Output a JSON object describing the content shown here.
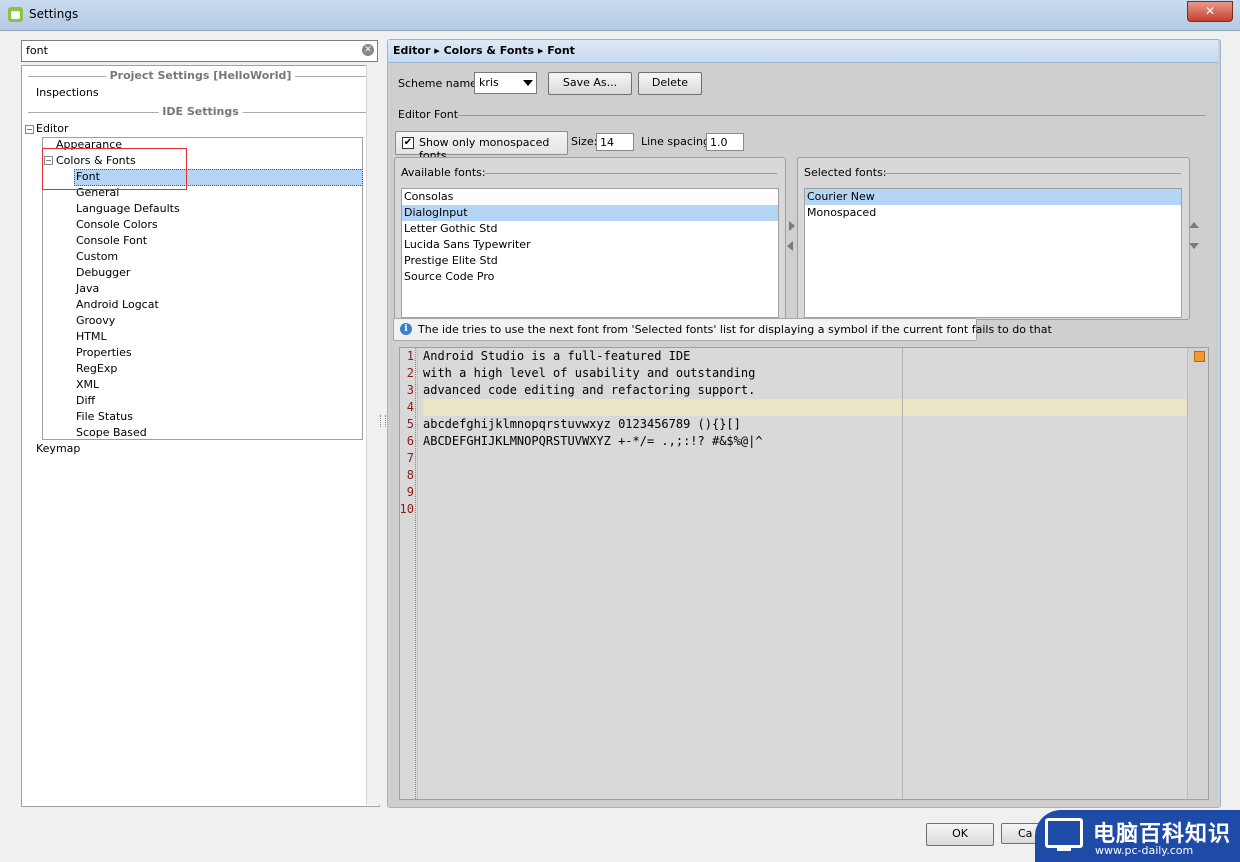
{
  "window": {
    "title": "Settings",
    "close_label": "✕"
  },
  "search": {
    "value": "font"
  },
  "tree": {
    "project_separator": "Project Settings [HelloWorld]",
    "ide_separator": "IDE Settings",
    "inspections": "Inspections",
    "editor": "Editor",
    "appearance": "Appearance",
    "colors_fonts": "Colors & Fonts",
    "children": [
      "Font",
      "General",
      "Language Defaults",
      "Console Colors",
      "Console Font",
      "Custom",
      "Debugger",
      "Java",
      "Android Logcat",
      "Groovy",
      "HTML",
      "Properties",
      "RegExp",
      "XML",
      "Diff",
      "File Status",
      "Scope Based"
    ],
    "keymap": "Keymap",
    "expander_minus": "−"
  },
  "breadcrumb": {
    "text": "Editor ▸ Colors & Fonts ▸ Font"
  },
  "scheme": {
    "label": "Scheme name:",
    "value": "kris",
    "save_as": "Save As...",
    "delete": "Delete"
  },
  "editor_font": {
    "section_label": "Editor Font",
    "mono_checkbox_label": "Show only monospaced fonts",
    "mono_checked": "✔",
    "size_label": "Size:",
    "size_value": "14",
    "spacing_label": "Line spacing:",
    "spacing_value": "1.0"
  },
  "available": {
    "label": "Available fonts:",
    "items": [
      "Consolas",
      "DialogInput",
      "Letter Gothic Std",
      "Lucida Sans Typewriter",
      "Prestige Elite Std",
      "Source Code Pro"
    ],
    "selected": "DialogInput"
  },
  "selected_fonts": {
    "label": "Selected fonts:",
    "items": [
      "Courier New",
      "Monospaced"
    ],
    "selected": "Courier New"
  },
  "info": {
    "icon": "i",
    "text": "The ide tries to use the next font from 'Selected fonts' list for displaying a symbol if the current font fails to do that"
  },
  "preview": {
    "line_numbers": [
      "1",
      "2",
      "3",
      "4",
      "5",
      "6",
      "7",
      "8",
      "9",
      "10"
    ],
    "lines": [
      "Android Studio is a full-featured IDE",
      "with a high level of usability and outstanding",
      "advanced code editing and refactoring support.",
      "",
      "abcdefghijklmnopqrstuvwxyz 0123456789 (){}[]",
      "ABCDEFGHIJKLMNOPQRSTUVWXYZ +-*/= .,;:!? #&$%@|^"
    ]
  },
  "footer": {
    "ok": "OK",
    "cancel": "Ca"
  },
  "watermark": {
    "title": "电脑百科知识",
    "url": "www.pc-daily.com"
  },
  "colors": {
    "selection": "#b5d5f7",
    "highlight_box": "#e23030",
    "caret_line": "#e8e6c4"
  }
}
